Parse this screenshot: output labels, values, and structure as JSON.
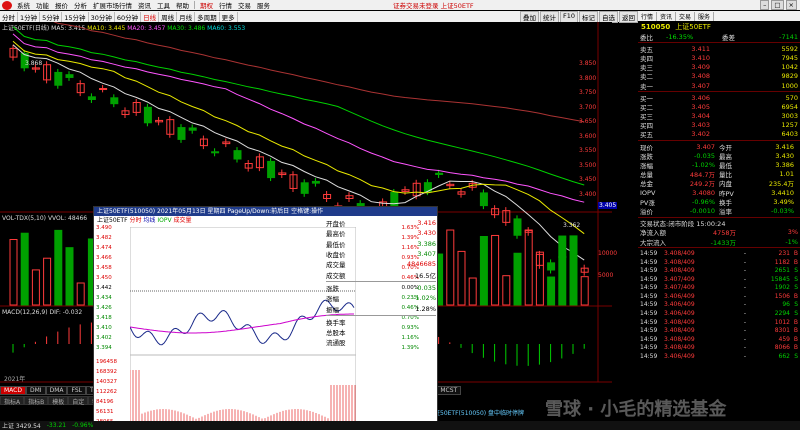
{
  "menubar": {
    "items": [
      "系统",
      "功能",
      "报价",
      "分析",
      "扩展市场行情",
      "资讯",
      "工具",
      "帮助"
    ],
    "extra": [
      "期权",
      "行情",
      "交易",
      "服务"
    ],
    "center_text": "证券交易未登录  上证50ETF",
    "right_items": [
      "上证50ETF",
      "行情",
      "资讯",
      "交易"
    ]
  },
  "periodbar": {
    "items": [
      "分时",
      "1分钟",
      "5分钟",
      "15分钟",
      "30分钟",
      "60分钟",
      "日线",
      "周线",
      "月线",
      "多周期",
      "更多"
    ],
    "active": "日线",
    "tools": [
      "叠加",
      "统计",
      "F10",
      "标记",
      "自选",
      "返回"
    ]
  },
  "main": {
    "legend1": {
      "name": "上证50ETF(日线)",
      "ma5": "MA5: 3.415",
      "ma10": "MA10: 3.445",
      "ma20": "MA20: 3.457",
      "ma30": "MA30: 3.486",
      "ma60": "MA60: 3.553"
    },
    "high_label": "3.868",
    "low_label": "3.362",
    "current_price_tag": "3.405",
    "yticks": [
      "3.850",
      "3.800",
      "3.750",
      "3.700",
      "3.650",
      "3.600",
      "3.550",
      "3.500",
      "3.450",
      "3.400"
    ],
    "vol_legend": {
      "name": "VOL-TDX(5,10)",
      "v": "VVOL: 48466"
    },
    "vol_ticks": [
      "10000",
      "5000"
    ],
    "macd_legend": {
      "name": "MACD(12,26,9)",
      "dif": "DIF: -0.032"
    },
    "bottom_year": "2021年",
    "tabs": [
      "MACD",
      "DMI",
      "DMA",
      "FSL",
      "TRIX",
      "BRAR",
      "CR",
      "VR",
      "OBV",
      "ASI",
      "EMV",
      "VOL-TDX",
      "RSI",
      "WR",
      "SAR",
      "KDJ",
      "CCI",
      "ROC",
      "MTM",
      "BOLL",
      "PSY",
      "MCST"
    ],
    "tab_active": "MACD",
    "tabs2": [
      "指标A",
      "指标B",
      "模板",
      "自定",
      "特色",
      "指标",
      "设置"
    ],
    "ticker": "上证50ETF(510050) 盘中临时停牌"
  },
  "popup": {
    "title": "上证50ETF(510050) 2021年05月13日 星期四 PageUp/Down:前后日 空格键:操作",
    "tab_name": "上证50ETF",
    "tab_a": "分时",
    "tab_b": "均线",
    "tab_c": "IOPV",
    "tab_d": "成交量",
    "left_ticks": [
      "3.490",
      "3.482",
      "3.474",
      "3.466",
      "3.458",
      "3.450",
      "3.442",
      "3.434",
      "3.426",
      "3.418",
      "3.410",
      "3.402",
      "3.394"
    ],
    "right_ticks": [
      "1.63%",
      "1.39%",
      "1.16%",
      "0.93%",
      "0.70%",
      "0.46%",
      "0.00%",
      "0.23%",
      "0.46%",
      "0.70%",
      "0.93%",
      "1.16%",
      "1.39%"
    ],
    "vol_ticks": [
      "196458",
      "168392",
      "140327",
      "112262",
      "84196",
      "56131",
      "28065"
    ],
    "stats": [
      {
        "k": "开盘价",
        "v": "3.416",
        "c": "red"
      },
      {
        "k": "最高价",
        "v": "3.430",
        "c": "red"
      },
      {
        "k": "最低价",
        "v": "3.386",
        "c": "green"
      },
      {
        "k": "收盘价",
        "v": "3.407",
        "c": "green"
      },
      {
        "k": "成交量",
        "v": "4846685",
        "c": "red"
      },
      {
        "k": "成交额",
        "v": "16.5亿",
        "c": ""
      }
    ],
    "stats2": [
      {
        "k": "涨跌",
        "v": "-0.035",
        "c": "green"
      },
      {
        "k": "涨幅",
        "v": "-1.02%",
        "c": "green"
      },
      {
        "k": "振幅",
        "v": "1.28%",
        "c": ""
      }
    ],
    "stats3": [
      "换手率",
      "总股本",
      "流通股"
    ]
  },
  "right": {
    "toolbar": [
      "行情",
      "资讯",
      "交易",
      "服务"
    ],
    "code": "510050",
    "name": "上证50ETF",
    "wb_label": "委比",
    "wb_value": "-16.35%",
    "wc_label": "委差",
    "wc_value": "-7141",
    "sells": [
      {
        "l": "卖五",
        "p": "3.411",
        "v": "5592"
      },
      {
        "l": "卖四",
        "p": "3.410",
        "v": "7945"
      },
      {
        "l": "卖三",
        "p": "3.409",
        "v": "1042"
      },
      {
        "l": "卖二",
        "p": "3.408",
        "v": "9829"
      },
      {
        "l": "卖一",
        "p": "3.407",
        "v": "1000"
      }
    ],
    "buys": [
      {
        "l": "买一",
        "p": "3.406",
        "v": "570"
      },
      {
        "l": "买二",
        "p": "3.405",
        "v": "6954"
      },
      {
        "l": "买三",
        "p": "3.404",
        "v": "3003"
      },
      {
        "l": "买四",
        "p": "3.403",
        "v": "1257"
      },
      {
        "l": "买五",
        "p": "3.402",
        "v": "6403"
      }
    ],
    "quote": [
      [
        "现价",
        "3.407",
        "今开",
        "3.416"
      ],
      [
        "涨跌",
        "-0.035",
        "最高",
        "3.430"
      ],
      [
        "涨幅",
        "-1.02%",
        "最低",
        "3.386"
      ],
      [
        "总量",
        "484.7万",
        "量比",
        "1.01"
      ],
      [
        "总金",
        "249.2万",
        "内盘",
        "235.4万"
      ],
      [
        "IOPV",
        "3.4080",
        "昨PV",
        "3.4410"
      ],
      [
        "PV涨",
        "-0.96%",
        "换手",
        "3.49%"
      ],
      [
        "溢价",
        "-0.0010",
        "溢率",
        "-0.03%"
      ]
    ],
    "status": "交易状态:闭市阶段 15:00:24",
    "flow_in": {
      "k": "净流入额",
      "v": "4758万",
      "pct": "3%"
    },
    "flow_big": {
      "k": "大宗流入",
      "v": "-1433万",
      "pct": "-1%"
    },
    "trades": [
      {
        "t": "14:59",
        "p": "3.408/409",
        "q": "-",
        "n": "231",
        "d": "B"
      },
      {
        "t": "14:59",
        "p": "3.408/409",
        "q": "-",
        "n": "1182",
        "d": "B"
      },
      {
        "t": "14:59",
        "p": "3.408/409",
        "q": "-",
        "n": "2651",
        "d": "S"
      },
      {
        "t": "14:59",
        "p": "3.407/409",
        "q": "-",
        "n": "15845",
        "d": "S"
      },
      {
        "t": "14:59",
        "p": "3.407/409",
        "q": "-",
        "n": "1902",
        "d": "S"
      },
      {
        "t": "14:59",
        "p": "3.406/409",
        "q": "-",
        "n": "1506",
        "d": "B"
      },
      {
        "t": "14:59",
        "p": "3.406/409",
        "q": "-",
        "n": "96",
        "d": "S"
      },
      {
        "t": "14:59",
        "p": "3.406/409",
        "q": "-",
        "n": "2294",
        "d": "S"
      },
      {
        "t": "14:59",
        "p": "3.408/409",
        "q": "-",
        "n": "1012",
        "d": "B"
      },
      {
        "t": "14:59",
        "p": "3.408/409",
        "q": "-",
        "n": "8301",
        "d": "B"
      },
      {
        "t": "14:59",
        "p": "3.408/409",
        "q": "-",
        "n": "459",
        "d": "B"
      },
      {
        "t": "14:59",
        "p": "3.408/409",
        "q": "-",
        "n": "8066",
        "d": "B"
      },
      {
        "t": "14:59",
        "p": "3.406/409",
        "q": "-",
        "n": "662",
        "d": "S"
      }
    ]
  },
  "statusbar": {
    "index": "上证 3429.54",
    "change": "-33.21",
    "pct": "-0.96%"
  },
  "watermark": "雪球 · 小毛的精选基金",
  "colors": {
    "up": "#ff3b3b",
    "down": "#00d000",
    "bg": "#000000"
  }
}
